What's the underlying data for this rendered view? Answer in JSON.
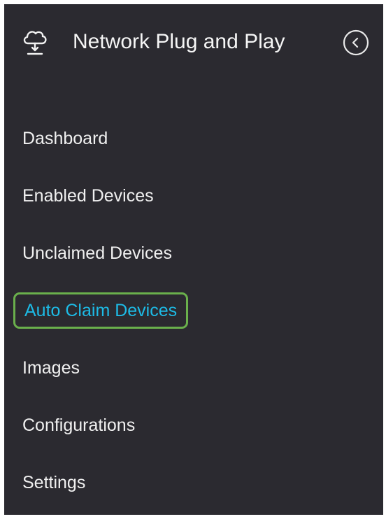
{
  "header": {
    "title": "Network Plug and Play",
    "app_icon": "cloud-network-icon",
    "collapse_icon": "chevron-left-circle-icon"
  },
  "nav": {
    "items": [
      {
        "label": "Dashboard",
        "active": false
      },
      {
        "label": "Enabled Devices",
        "active": false
      },
      {
        "label": "Unclaimed Devices",
        "active": false
      },
      {
        "label": "Auto Claim Devices",
        "active": true
      },
      {
        "label": "Images",
        "active": false
      },
      {
        "label": "Configurations",
        "active": false
      },
      {
        "label": "Settings",
        "active": false
      }
    ]
  },
  "colors": {
    "sidebar_bg": "#2b2a30",
    "text": "#f0f0f0",
    "active_text": "#1dbbe6",
    "highlight_border": "#6ab04c"
  }
}
